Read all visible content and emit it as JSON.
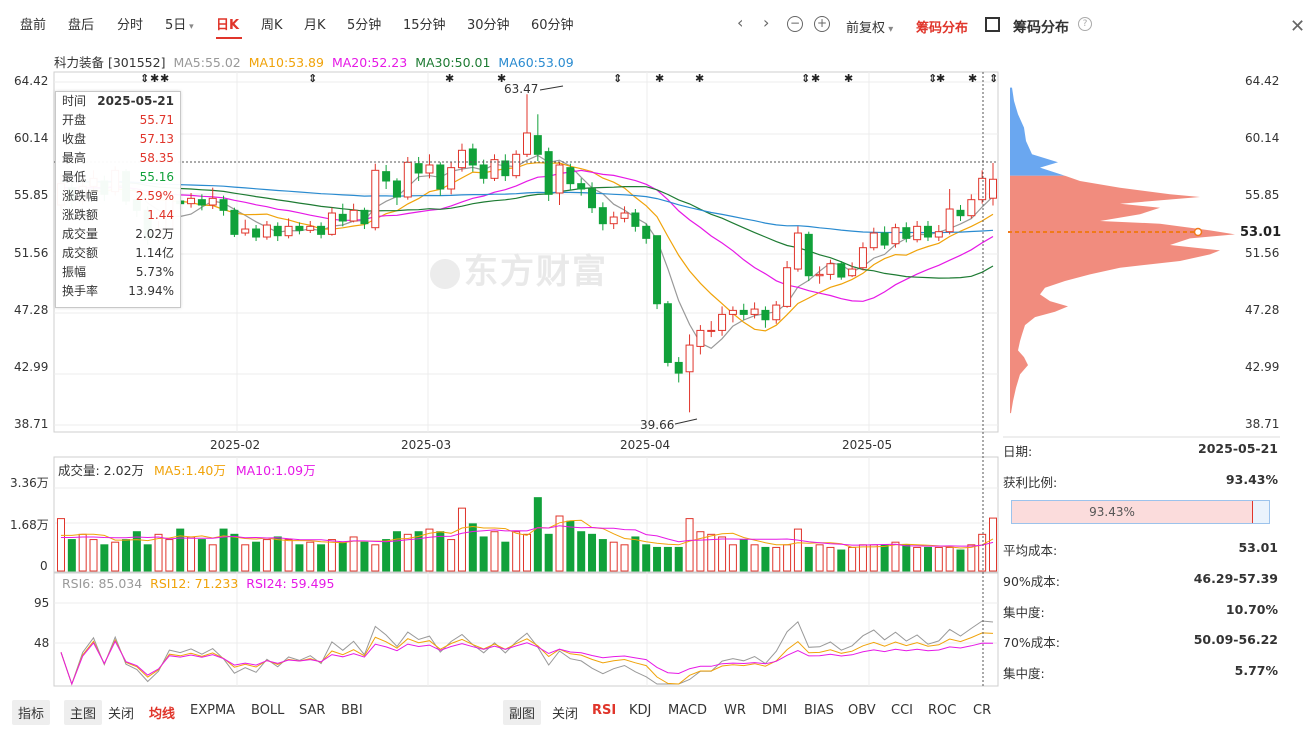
{
  "top_tabs": [
    "盘前",
    "盘后",
    "分时",
    "5日",
    "日K",
    "周K",
    "月K",
    "5分钟",
    "15分钟",
    "30分钟",
    "60分钟"
  ],
  "active_tab": "日K",
  "top_right": {
    "fuquan": "前复权",
    "chouma_btn": "筹码分布",
    "chouma_title": "筹码分布"
  },
  "stock": {
    "name_code": "科力装备 [301552]"
  },
  "ma": {
    "ma5": "MA5:55.02",
    "ma10": "MA10:53.89",
    "ma20": "MA20:52.23",
    "ma30": "MA30:50.01",
    "ma60": "MA60:53.09"
  },
  "colors": {
    "up": "#e0352b",
    "down": "#11a13a",
    "ma5": "#999999",
    "ma10": "#f0a30a",
    "ma20": "#e619e6",
    "ma30": "#1e7b33",
    "ma60": "#2a8bd0",
    "chip_profit": "#6aa7f0",
    "chip_loss": "#f08070"
  },
  "price_axis": [
    "64.42",
    "60.14",
    "55.85",
    "51.56",
    "47.28",
    "42.99",
    "38.71"
  ],
  "right_axis": [
    "64.42",
    "60.14",
    "55.85",
    "51.56",
    "47.28",
    "42.99",
    "38.71"
  ],
  "dates": [
    "2025-02",
    "2025-03",
    "2025-04",
    "2025-05"
  ],
  "annotations": {
    "high": "63.47",
    "low": "39.66"
  },
  "tooltip": {
    "time_label": "时间",
    "time": "2025-05-21",
    "open_label": "开盘",
    "open": "55.71",
    "close_label": "收盘",
    "close": "57.13",
    "high_label": "最高",
    "high": "58.35",
    "low_label": "最低",
    "low": "55.16",
    "pct_label": "涨跌幅",
    "pct": "2.59%",
    "chg_label": "涨跌额",
    "chg": "1.44",
    "vol_label": "成交量",
    "vol": "2.02万",
    "amt_label": "成交额",
    "amt": "1.14亿",
    "amp_label": "振幅",
    "amp": "5.73%",
    "turn_label": "换手率",
    "turn": "13.94%"
  },
  "watermark": "东方财富",
  "volume": {
    "label": "成交量: 2.02万",
    "ma5": "MA5:1.40万",
    "ma10": "MA10:1.09万",
    "axis": [
      "3.36万",
      "1.68万",
      "0"
    ]
  },
  "rsi": {
    "rsi6": "RSI6: 85.034",
    "rsi12": "RSI12: 71.233",
    "rsi24": "RSI24: 59.495",
    "axis": [
      "95",
      "48",
      "1"
    ]
  },
  "chip_info": {
    "date_label": "日期:",
    "date": "2025-05-21",
    "profit_label": "获利比例:",
    "profit": "93.43%",
    "profit_bar": "93.43%",
    "profit_frac": 0.9343,
    "avg_label": "平均成本:",
    "avg": "53.01",
    "c90_label": "90%成本:",
    "c90": "46.29-57.39",
    "conc1_label": "集中度:",
    "conc1": "10.70%",
    "c70_label": "70%成本:",
    "c70": "50.09-56.22",
    "conc2_label": "集中度:",
    "conc2": "5.77%",
    "avg_marker": "53.01"
  },
  "bottom_left": [
    "指标",
    "主图",
    "关闭",
    "均线",
    "EXPMA",
    "BOLL",
    "SAR",
    "BBI"
  ],
  "bottom_right": [
    "副图",
    "关闭",
    "RSI",
    "KDJ",
    "MACD",
    "WR",
    "DMI",
    "BIAS",
    "OBV",
    "CCI",
    "ROC",
    "CR"
  ]
}
